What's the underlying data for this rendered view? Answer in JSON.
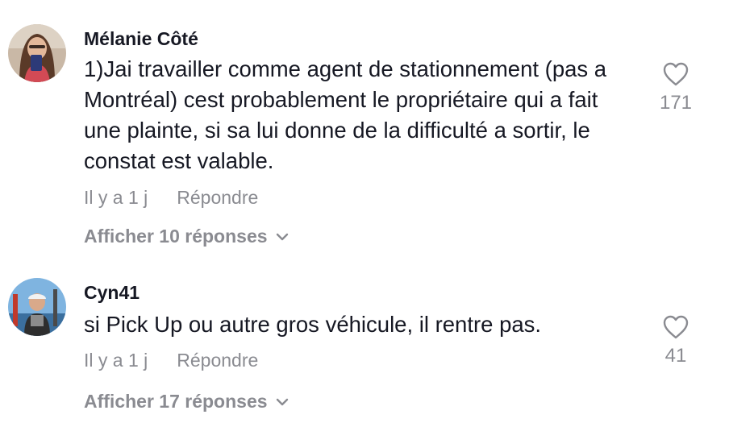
{
  "comments": [
    {
      "username": "Mélanie Côté",
      "text": "1)Jai travailler comme agent de stationnement (pas a Montréal) cest probablement le propriétaire qui a fait une plainte, si sa lui donne de la difficulté a sortir, le constat est valable.",
      "time": "Il y a 1 j",
      "reply_label": "Répondre",
      "view_replies_label": "Afficher 10 réponses",
      "like_count": "171",
      "avatar_icon": "user-avatar-selfie"
    },
    {
      "username": "Cyn41",
      "text": "si Pick Up ou autre gros véhicule, il rentre pas.",
      "time": "Il y a 1 j",
      "reply_label": "Répondre",
      "view_replies_label": "Afficher 17 réponses",
      "like_count": "41",
      "avatar_icon": "user-avatar-outdoor"
    }
  ],
  "colors": {
    "text": "#161823",
    "muted": "#8a8b91",
    "background": "#ffffff"
  },
  "icons": {
    "like": "heart-outline-icon",
    "expand": "chevron-down-icon"
  }
}
